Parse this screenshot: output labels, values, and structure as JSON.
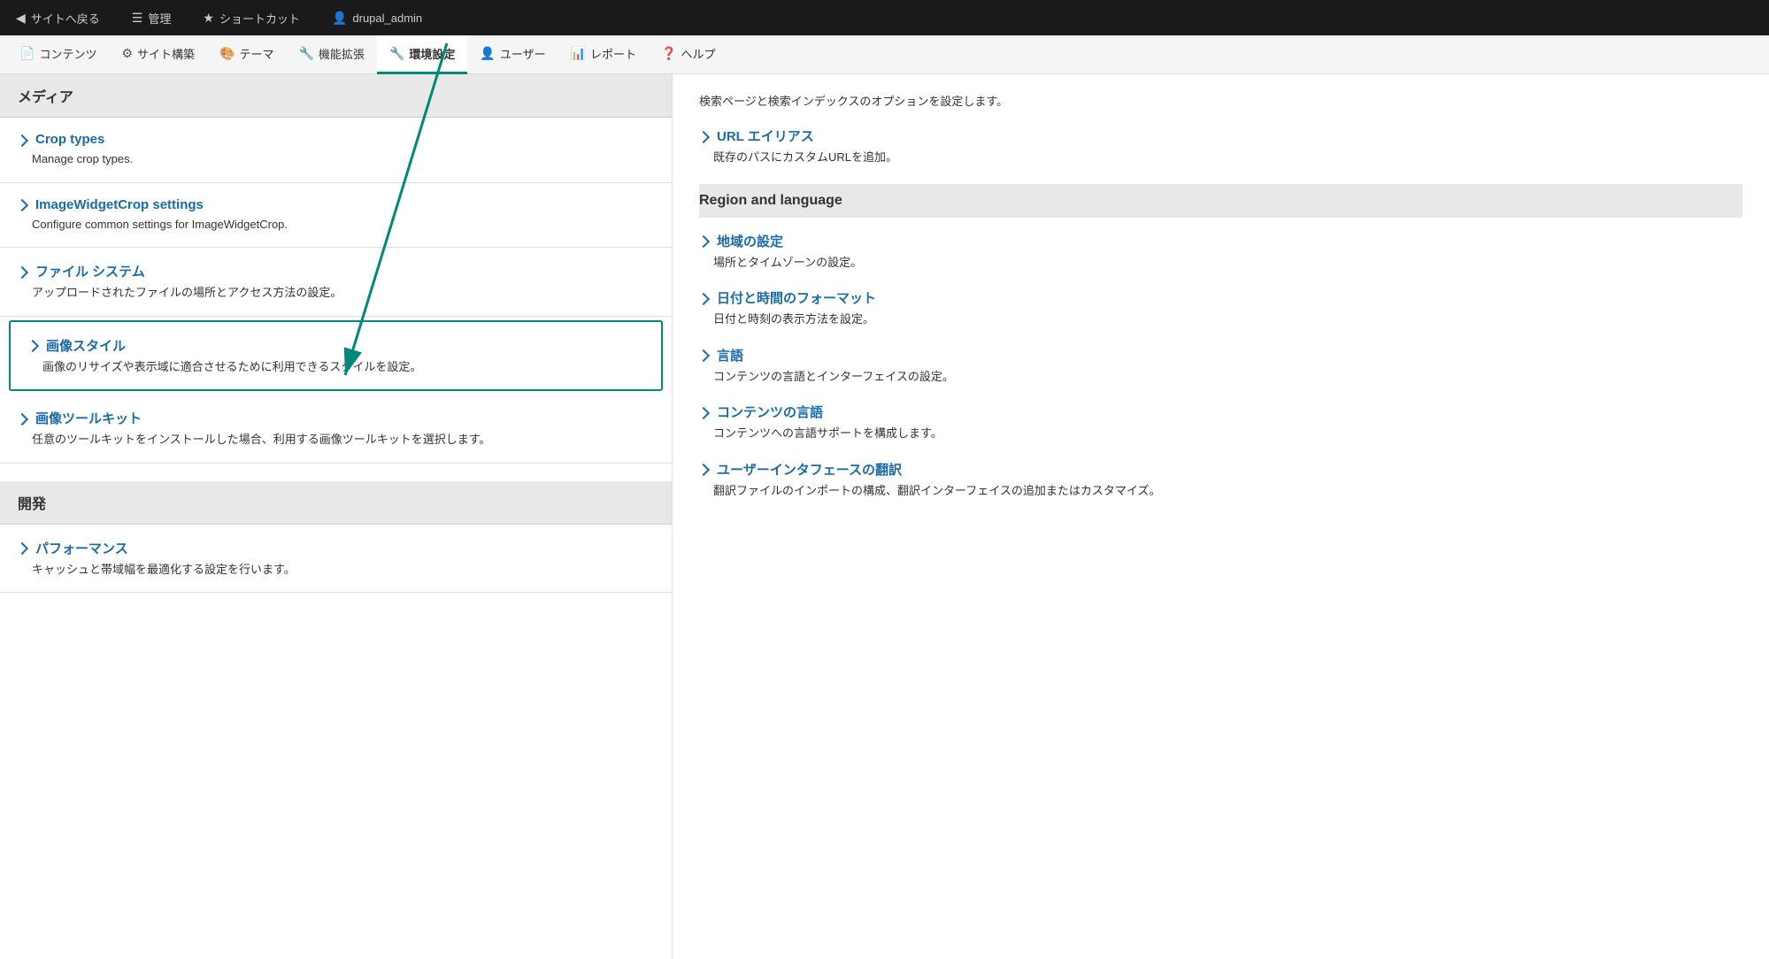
{
  "admin_bar": {
    "back_to_site": "サイトへ戻る",
    "manage": "管理",
    "shortcuts": "ショートカット",
    "user": "drupal_admin"
  },
  "nav": {
    "items": [
      {
        "label": "コンテンツ",
        "icon": "📄",
        "active": false
      },
      {
        "label": "サイト構築",
        "icon": "⚙",
        "active": false
      },
      {
        "label": "テーマ",
        "icon": "🎨",
        "active": false
      },
      {
        "label": "機能拡張",
        "icon": "🔧",
        "active": false
      },
      {
        "label": "環境設定",
        "icon": "🔧",
        "active": true
      },
      {
        "label": "ユーザー",
        "icon": "👤",
        "active": false
      },
      {
        "label": "レポート",
        "icon": "📊",
        "active": false
      },
      {
        "label": "ヘルプ",
        "icon": "❓",
        "active": false
      }
    ]
  },
  "media_section": {
    "header": "メディア",
    "items": [
      {
        "title": "Crop types",
        "desc": "Manage crop types.",
        "highlighted": false
      },
      {
        "title": "ImageWidgetCrop settings",
        "desc": "Configure common settings for ImageWidgetCrop.",
        "highlighted": false
      },
      {
        "title": "ファイル システム",
        "desc": "アップロードされたファイルの場所とアクセス方法の設定。",
        "highlighted": false
      },
      {
        "title": "画像スタイル",
        "desc": "画像のリサイズや表示域に適合させるために利用できるスタイルを設定。",
        "highlighted": true
      },
      {
        "title": "画像ツールキット",
        "desc": "任意のツールキットをインストールした場合、利用する画像ツールキットを選択します。",
        "highlighted": false
      }
    ]
  },
  "dev_section": {
    "header": "開発",
    "items": [
      {
        "title": "パフォーマンス",
        "desc": "キャッシュと帯域幅を最適化する設定を行います。"
      }
    ]
  },
  "right_col": {
    "top_desc": "検索ページと検索インデックスのオプションを設定します。",
    "url_alias": {
      "title": "URL エイリアス",
      "desc": "既存のパスにカスタムURLを追加。"
    },
    "region_language_header": "Region and language",
    "items": [
      {
        "title": "地域の設定",
        "desc": "場所とタイムゾーンの設定。"
      },
      {
        "title": "日付と時間のフォーマット",
        "desc": "日付と時刻の表示方法を設定。"
      },
      {
        "title": "言語",
        "desc": "コンテンツの言語とインターフェイスの設定。"
      },
      {
        "title": "コンテンツの言語",
        "desc": "コンテンツへの言語サポートを構成します。"
      },
      {
        "title": "ユーザーインタフェースの翻訳",
        "desc": "翻訳ファイルのインポートの構成、翻訳インターフェイスの追加またはカスタマイズ。"
      }
    ]
  }
}
